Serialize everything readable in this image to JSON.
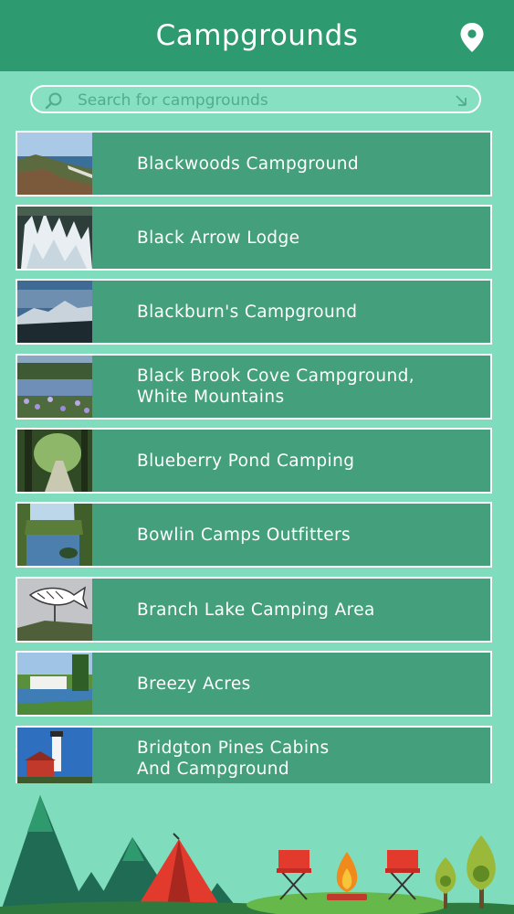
{
  "header": {
    "title": "Campgrounds",
    "location_icon": "map-pin-icon"
  },
  "search": {
    "placeholder": "Search for campgrounds",
    "value": "",
    "icon": "search-icon",
    "clear_icon": "clear-icon"
  },
  "campgrounds": [
    {
      "name": "Blackwoods Campground",
      "thumb": "coastline"
    },
    {
      "name": "Black Arrow Lodge",
      "thumb": "frozen-falls"
    },
    {
      "name": "Blackburn's Campground",
      "thumb": "mountain-dusk"
    },
    {
      "name": "Black Brook Cove Campground,\nWhite Mountains",
      "thumb": "lake-flowers"
    },
    {
      "name": "Blueberry Pond Camping",
      "thumb": "forest-path"
    },
    {
      "name": "Bowlin Camps Outfitters",
      "thumb": "river-trees"
    },
    {
      "name": "Branch Lake Camping Area",
      "thumb": "fish-sign"
    },
    {
      "name": "Breezy Acres",
      "thumb": "lakeside-cabin"
    },
    {
      "name": "Bridgton Pines Cabins\nAnd Campground",
      "thumb": "lighthouse"
    }
  ],
  "colors": {
    "header": "#2e9a70",
    "background": "#7fdcbc",
    "row": "#44a07c",
    "text": "#ffffff"
  }
}
